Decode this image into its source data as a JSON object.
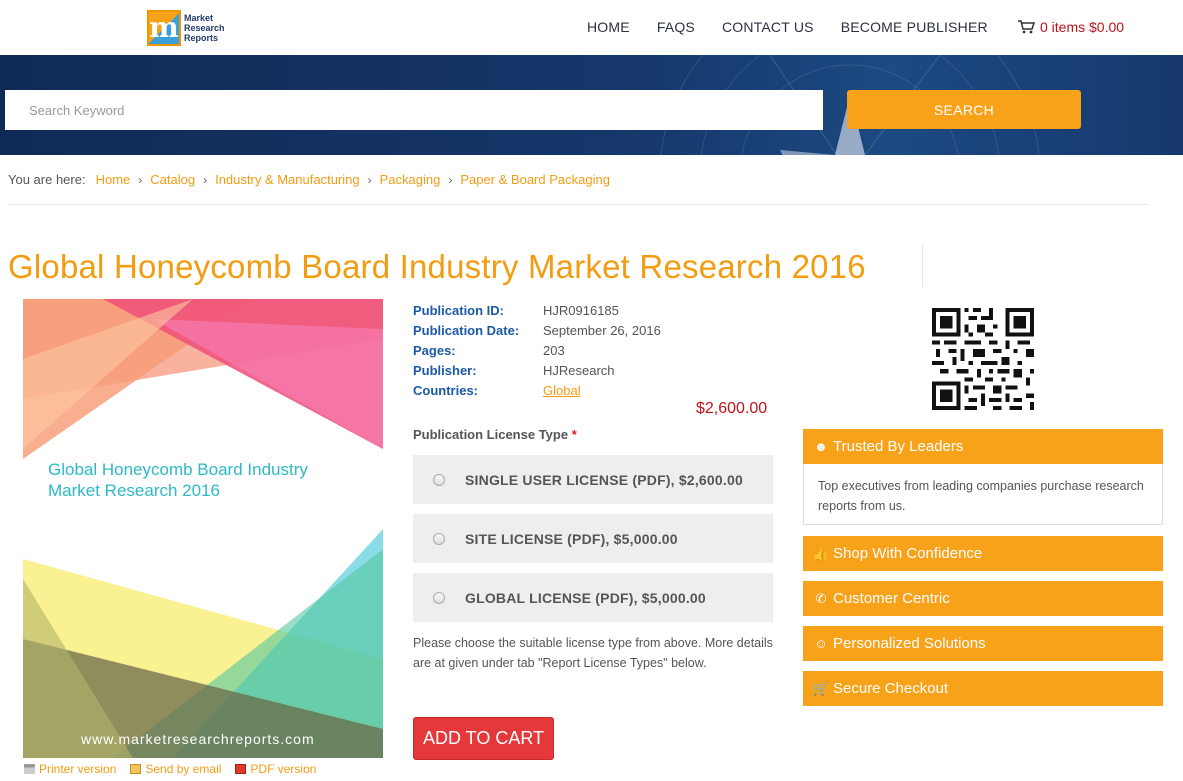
{
  "header": {
    "logo_mark": "m",
    "logo_lines": [
      "Market",
      "Research",
      "Reports"
    ],
    "nav": [
      "HOME",
      "FAQS",
      "CONTACT US",
      "BECOME PUBLISHER"
    ],
    "cart_label": "0 items $0.00"
  },
  "search": {
    "placeholder": "Search Keyword",
    "button_label": "SEARCH"
  },
  "breadcrumb": {
    "label": "You are here:",
    "items": [
      "Home",
      "Catalog",
      "Industry & Manufacturing",
      "Packaging",
      "Paper & Board Packaging"
    ]
  },
  "page_title": "Global Honeycomb Board Industry Market Research 2016",
  "cover": {
    "title": "Global Honeycomb Board Industry Market Research 2016",
    "url": "www.marketresearchreports.com"
  },
  "under_links": [
    "Printer version",
    "Send by email",
    "PDF version"
  ],
  "details": [
    {
      "key": "Publication ID:",
      "value": "HJR0916185"
    },
    {
      "key": "Publication Date:",
      "value": "September 26, 2016"
    },
    {
      "key": "Pages:",
      "value": "203"
    },
    {
      "key": "Publisher:",
      "value": "HJResearch"
    },
    {
      "key": "Countries:",
      "value": "Global"
    }
  ],
  "price": "$2,600.00",
  "license": {
    "label": "Publication License Type",
    "required_mark": "*",
    "options": [
      "SINGLE USER LICENSE (PDF), $2,600.00",
      "SITE LICENSE (PDF), $5,000.00",
      "GLOBAL LICENSE (PDF), $5,000.00"
    ],
    "note": "Please choose the suitable license type from above. More details are at given under tab \"Report License Types\" below."
  },
  "add_to_cart": "ADD TO CART",
  "panels": {
    "trusted": {
      "title": "Trusted By Leaders",
      "body": "Top executives from leading companies purchase research reports from us."
    },
    "items": [
      "Shop With Confidence",
      "Customer Centric",
      "Personalized Solutions",
      "Secure Checkout"
    ]
  },
  "colors": {
    "accent": "#f8a21a",
    "link": "#f39c12",
    "price": "#c0111b",
    "cart_button": "#e5383b",
    "label_blue": "#1a5aa6"
  }
}
